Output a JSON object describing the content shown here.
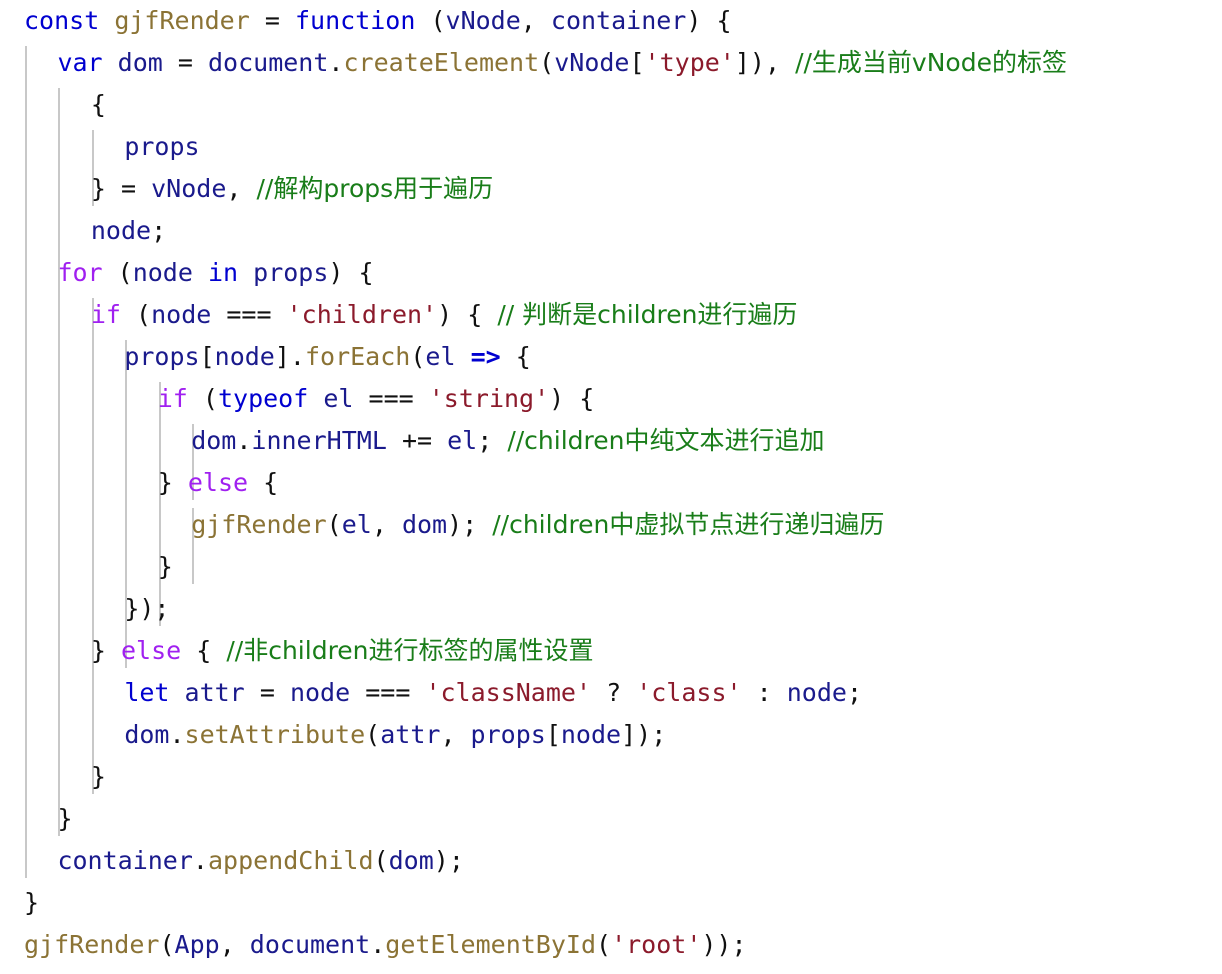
{
  "editor": {
    "language": "javascript",
    "background_color": "#ffffff",
    "indent_guide_color": "#c8c8c8",
    "font_size_px": 25,
    "line_height_px": 42,
    "total_lines": 23
  },
  "theme": {
    "keyword_blue": "#0000d0",
    "keyword_purple": "#a020f0",
    "identifier": "#1a1a8c",
    "function_name": "#8b7335",
    "string": "#8b1a2b",
    "comment": "#197d19",
    "punctuation": "#101010"
  },
  "code": {
    "lines": [
      {
        "n": 1,
        "indent": 0,
        "text": "const gjfRender = function (vNode, container) {",
        "tokens": [
          {
            "t": "const",
            "c": "kw"
          },
          {
            "t": " ",
            "c": "punc"
          },
          {
            "t": "gjfRender",
            "c": "fn"
          },
          {
            "t": " ",
            "c": "punc"
          },
          {
            "t": "=",
            "c": "op"
          },
          {
            "t": " ",
            "c": "punc"
          },
          {
            "t": "function",
            "c": "kw"
          },
          {
            "t": " (",
            "c": "punc"
          },
          {
            "t": "vNode",
            "c": "ident"
          },
          {
            "t": ", ",
            "c": "punc"
          },
          {
            "t": "container",
            "c": "ident"
          },
          {
            "t": ") {",
            "c": "punc"
          }
        ]
      },
      {
        "n": 2,
        "indent": 1,
        "text": "var dom = document.createElement(vNode['type']), //生成当前vNode的标签",
        "tokens": [
          {
            "t": "var",
            "c": "kw"
          },
          {
            "t": " ",
            "c": "punc"
          },
          {
            "t": "dom",
            "c": "ident"
          },
          {
            "t": " ",
            "c": "punc"
          },
          {
            "t": "=",
            "c": "op"
          },
          {
            "t": " ",
            "c": "punc"
          },
          {
            "t": "document",
            "c": "ident"
          },
          {
            "t": ".",
            "c": "punc"
          },
          {
            "t": "createElement",
            "c": "fn"
          },
          {
            "t": "(",
            "c": "punc"
          },
          {
            "t": "vNode",
            "c": "ident"
          },
          {
            "t": "[",
            "c": "punc"
          },
          {
            "t": "'type'",
            "c": "str"
          },
          {
            "t": "]), ",
            "c": "punc"
          },
          {
            "t": "//生成当前vNode的标签",
            "c": "com"
          }
        ]
      },
      {
        "n": 3,
        "indent": 2,
        "text": "{",
        "tokens": [
          {
            "t": "{",
            "c": "punc"
          }
        ]
      },
      {
        "n": 4,
        "indent": 3,
        "text": "props",
        "tokens": [
          {
            "t": "props",
            "c": "ident"
          }
        ]
      },
      {
        "n": 5,
        "indent": 2,
        "text": "} = vNode, //解构props用于遍历",
        "tokens": [
          {
            "t": "}",
            "c": "punc"
          },
          {
            "t": " ",
            "c": "punc"
          },
          {
            "t": "=",
            "c": "op"
          },
          {
            "t": " ",
            "c": "punc"
          },
          {
            "t": "vNode",
            "c": "ident"
          },
          {
            "t": ", ",
            "c": "punc"
          },
          {
            "t": "//解构props用于遍历",
            "c": "com"
          }
        ]
      },
      {
        "n": 6,
        "indent": 2,
        "text": "node;",
        "tokens": [
          {
            "t": "node",
            "c": "ident"
          },
          {
            "t": ";",
            "c": "punc"
          }
        ]
      },
      {
        "n": 7,
        "indent": 1,
        "text": "for (node in props) {",
        "tokens": [
          {
            "t": "for",
            "c": "kwp"
          },
          {
            "t": " (",
            "c": "punc"
          },
          {
            "t": "node",
            "c": "ident"
          },
          {
            "t": " ",
            "c": "punc"
          },
          {
            "t": "in",
            "c": "kw"
          },
          {
            "t": " ",
            "c": "punc"
          },
          {
            "t": "props",
            "c": "ident"
          },
          {
            "t": ") {",
            "c": "punc"
          }
        ]
      },
      {
        "n": 8,
        "indent": 2,
        "text": "if (node === 'children') { // 判断是children进行遍历",
        "tokens": [
          {
            "t": "if",
            "c": "kwp"
          },
          {
            "t": " (",
            "c": "punc"
          },
          {
            "t": "node",
            "c": "ident"
          },
          {
            "t": " ",
            "c": "punc"
          },
          {
            "t": "===",
            "c": "op"
          },
          {
            "t": " ",
            "c": "punc"
          },
          {
            "t": "'children'",
            "c": "str"
          },
          {
            "t": ") { ",
            "c": "punc"
          },
          {
            "t": "// 判断是children进行遍历",
            "c": "com"
          }
        ]
      },
      {
        "n": 9,
        "indent": 3,
        "text": "props[node].forEach(el => {",
        "tokens": [
          {
            "t": "props",
            "c": "ident"
          },
          {
            "t": "[",
            "c": "punc"
          },
          {
            "t": "node",
            "c": "ident"
          },
          {
            "t": "].",
            "c": "punc"
          },
          {
            "t": "forEach",
            "c": "fn"
          },
          {
            "t": "(",
            "c": "punc"
          },
          {
            "t": "el",
            "c": "ident"
          },
          {
            "t": " ",
            "c": "punc"
          },
          {
            "t": "=>",
            "c": "arrow"
          },
          {
            "t": " {",
            "c": "punc"
          }
        ]
      },
      {
        "n": 10,
        "indent": 4,
        "text": "if (typeof el === 'string') {",
        "tokens": [
          {
            "t": "if",
            "c": "kwp"
          },
          {
            "t": " (",
            "c": "punc"
          },
          {
            "t": "typeof",
            "c": "kw"
          },
          {
            "t": " ",
            "c": "punc"
          },
          {
            "t": "el",
            "c": "ident"
          },
          {
            "t": " ",
            "c": "punc"
          },
          {
            "t": "===",
            "c": "op"
          },
          {
            "t": " ",
            "c": "punc"
          },
          {
            "t": "'string'",
            "c": "str"
          },
          {
            "t": ") {",
            "c": "punc"
          }
        ]
      },
      {
        "n": 11,
        "indent": 5,
        "text": "dom.innerHTML += el; //children中纯文本进行追加",
        "tokens": [
          {
            "t": "dom",
            "c": "ident"
          },
          {
            "t": ".",
            "c": "punc"
          },
          {
            "t": "innerHTML",
            "c": "ident"
          },
          {
            "t": " ",
            "c": "punc"
          },
          {
            "t": "+=",
            "c": "op"
          },
          {
            "t": " ",
            "c": "punc"
          },
          {
            "t": "el",
            "c": "ident"
          },
          {
            "t": "; ",
            "c": "punc"
          },
          {
            "t": "//children中纯文本进行追加",
            "c": "com"
          }
        ]
      },
      {
        "n": 12,
        "indent": 4,
        "text": "} else {",
        "tokens": [
          {
            "t": "}",
            "c": "punc"
          },
          {
            "t": " ",
            "c": "punc"
          },
          {
            "t": "else",
            "c": "kwp"
          },
          {
            "t": " {",
            "c": "punc"
          }
        ]
      },
      {
        "n": 13,
        "indent": 5,
        "text": "gjfRender(el, dom); //children中虚拟节点进行递归遍历",
        "tokens": [
          {
            "t": "gjfRender",
            "c": "fn"
          },
          {
            "t": "(",
            "c": "punc"
          },
          {
            "t": "el",
            "c": "ident"
          },
          {
            "t": ", ",
            "c": "punc"
          },
          {
            "t": "dom",
            "c": "ident"
          },
          {
            "t": "); ",
            "c": "punc"
          },
          {
            "t": "//children中虚拟节点进行递归遍历",
            "c": "com"
          }
        ]
      },
      {
        "n": 14,
        "indent": 4,
        "text": "}",
        "tokens": [
          {
            "t": "}",
            "c": "punc"
          }
        ]
      },
      {
        "n": 15,
        "indent": 3,
        "text": "});",
        "tokens": [
          {
            "t": "});",
            "c": "punc"
          }
        ]
      },
      {
        "n": 16,
        "indent": 2,
        "text": "} else { //非children进行标签的属性设置",
        "tokens": [
          {
            "t": "}",
            "c": "punc"
          },
          {
            "t": " ",
            "c": "punc"
          },
          {
            "t": "else",
            "c": "kwp"
          },
          {
            "t": " { ",
            "c": "punc"
          },
          {
            "t": "//非children进行标签的属性设置",
            "c": "com"
          }
        ]
      },
      {
        "n": 17,
        "indent": 3,
        "text": "let attr = node === 'className' ? 'class' : node;",
        "tokens": [
          {
            "t": "let",
            "c": "kw"
          },
          {
            "t": " ",
            "c": "punc"
          },
          {
            "t": "attr",
            "c": "ident"
          },
          {
            "t": " ",
            "c": "punc"
          },
          {
            "t": "=",
            "c": "op"
          },
          {
            "t": " ",
            "c": "punc"
          },
          {
            "t": "node",
            "c": "ident"
          },
          {
            "t": " ",
            "c": "punc"
          },
          {
            "t": "===",
            "c": "op"
          },
          {
            "t": " ",
            "c": "punc"
          },
          {
            "t": "'className'",
            "c": "str"
          },
          {
            "t": " ",
            "c": "punc"
          },
          {
            "t": "?",
            "c": "op"
          },
          {
            "t": " ",
            "c": "punc"
          },
          {
            "t": "'class'",
            "c": "str"
          },
          {
            "t": " ",
            "c": "punc"
          },
          {
            "t": ":",
            "c": "op"
          },
          {
            "t": " ",
            "c": "punc"
          },
          {
            "t": "node",
            "c": "ident"
          },
          {
            "t": ";",
            "c": "punc"
          }
        ]
      },
      {
        "n": 18,
        "indent": 3,
        "text": "dom.setAttribute(attr, props[node]);",
        "tokens": [
          {
            "t": "dom",
            "c": "ident"
          },
          {
            "t": ".",
            "c": "punc"
          },
          {
            "t": "setAttribute",
            "c": "fn"
          },
          {
            "t": "(",
            "c": "punc"
          },
          {
            "t": "attr",
            "c": "ident"
          },
          {
            "t": ", ",
            "c": "punc"
          },
          {
            "t": "props",
            "c": "ident"
          },
          {
            "t": "[",
            "c": "punc"
          },
          {
            "t": "node",
            "c": "ident"
          },
          {
            "t": "]);",
            "c": "punc"
          }
        ]
      },
      {
        "n": 19,
        "indent": 2,
        "text": "}",
        "tokens": [
          {
            "t": "}",
            "c": "punc"
          }
        ]
      },
      {
        "n": 20,
        "indent": 1,
        "text": "}",
        "tokens": [
          {
            "t": "}",
            "c": "punc"
          }
        ]
      },
      {
        "n": 21,
        "indent": 1,
        "text": "container.appendChild(dom);",
        "tokens": [
          {
            "t": "container",
            "c": "ident"
          },
          {
            "t": ".",
            "c": "punc"
          },
          {
            "t": "appendChild",
            "c": "fn"
          },
          {
            "t": "(",
            "c": "punc"
          },
          {
            "t": "dom",
            "c": "ident"
          },
          {
            "t": ");",
            "c": "punc"
          }
        ]
      },
      {
        "n": 22,
        "indent": 0,
        "text": "}",
        "tokens": [
          {
            "t": "}",
            "c": "punc"
          }
        ]
      },
      {
        "n": 23,
        "indent": 0,
        "text": "gjfRender(App, document.getElementById('root'));",
        "tokens": [
          {
            "t": "gjfRender",
            "c": "fn"
          },
          {
            "t": "(",
            "c": "punc"
          },
          {
            "t": "App",
            "c": "ident"
          },
          {
            "t": ", ",
            "c": "punc"
          },
          {
            "t": "document",
            "c": "ident"
          },
          {
            "t": ".",
            "c": "punc"
          },
          {
            "t": "getElementById",
            "c": "fn"
          },
          {
            "t": "(",
            "c": "punc"
          },
          {
            "t": "'root'",
            "c": "str"
          },
          {
            "t": "));",
            "c": "punc"
          }
        ]
      }
    ],
    "indent_guides": [
      {
        "level": 1,
        "from_line": 2,
        "to_line": 21
      },
      {
        "level": 2,
        "from_line": 3,
        "to_line": 20
      },
      {
        "level": 3,
        "from_line": 4,
        "to_line": 5
      },
      {
        "level": 3,
        "from_line": 8,
        "to_line": 19
      },
      {
        "level": 4,
        "from_line": 9,
        "to_line": 16
      },
      {
        "level": 5,
        "from_line": 10,
        "to_line": 15
      },
      {
        "level": 6,
        "from_line": 11,
        "to_line": 12
      },
      {
        "level": 6,
        "from_line": 13,
        "to_line": 14
      }
    ]
  }
}
